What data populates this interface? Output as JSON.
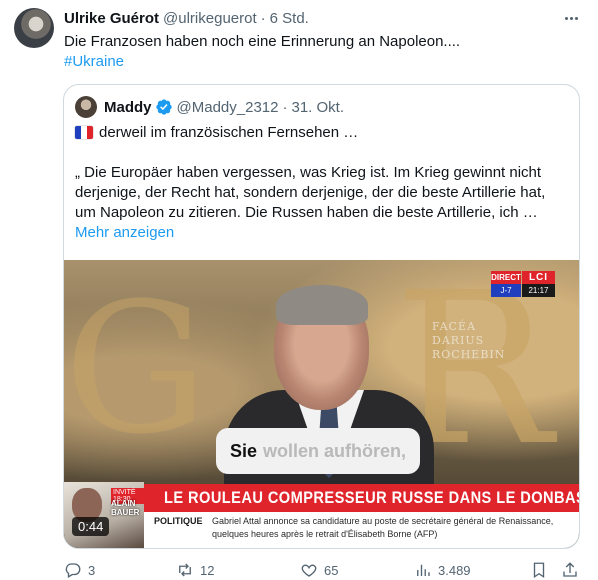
{
  "tweet": {
    "author_name": "Ulrike Guérot",
    "author_handle": "@ulrikeguerot",
    "separator": "·",
    "time": "6 Std.",
    "text": "Die Franzosen haben noch eine Erinnerung an Napoleon....",
    "hashtag": "#Ukraine"
  },
  "quote": {
    "author_name": "Maddy",
    "author_handle": "@Maddy_2312",
    "separator": "·",
    "time": "31. Okt.",
    "line1": "derweil im französischen Fernsehen …",
    "body": "„ Die Europäer haben vergessen, was Krieg ist. Im Krieg gewinnt nicht derjenige, der Recht hat, sondern derjenige, der die beste Artillerie hat, um Napoleon zu zitieren. Die Russen haben die beste Artillerie, ich …",
    "show_more": "Mehr anzeigen"
  },
  "video": {
    "wall_caption": [
      "FACÉA",
      "DARIUS",
      "ROCHEBIN"
    ],
    "lci_direct": "DIRECT",
    "lci_logo": "LCI",
    "lci_day": "J-7",
    "lci_clock": "21:17",
    "subtitle_strong": "Sie",
    "subtitle_light": "wollen aufhören,",
    "banner": "LE ROULEAU COMPRESSEUR RUSSE DANS LE DONBASS",
    "invite_label": "INVITÉ 18:30",
    "inset_name": [
      "ALAIN",
      "BAUER"
    ],
    "ticker_label": "POLITIQUE",
    "ticker_text": "Gabriel Attal annonce sa candidature au poste de secrétaire général de Renaissance, quelques heures après le retrait d'Élisabeth Borne (AFP)",
    "duration": "0:44"
  },
  "actions": {
    "replies": "3",
    "reposts": "12",
    "likes": "65",
    "views": "3.489"
  },
  "colors": {
    "accent": "#1d9bf0",
    "secondary_text": "#536471",
    "border": "#cfd9de",
    "lci_red": "#e0242b"
  }
}
